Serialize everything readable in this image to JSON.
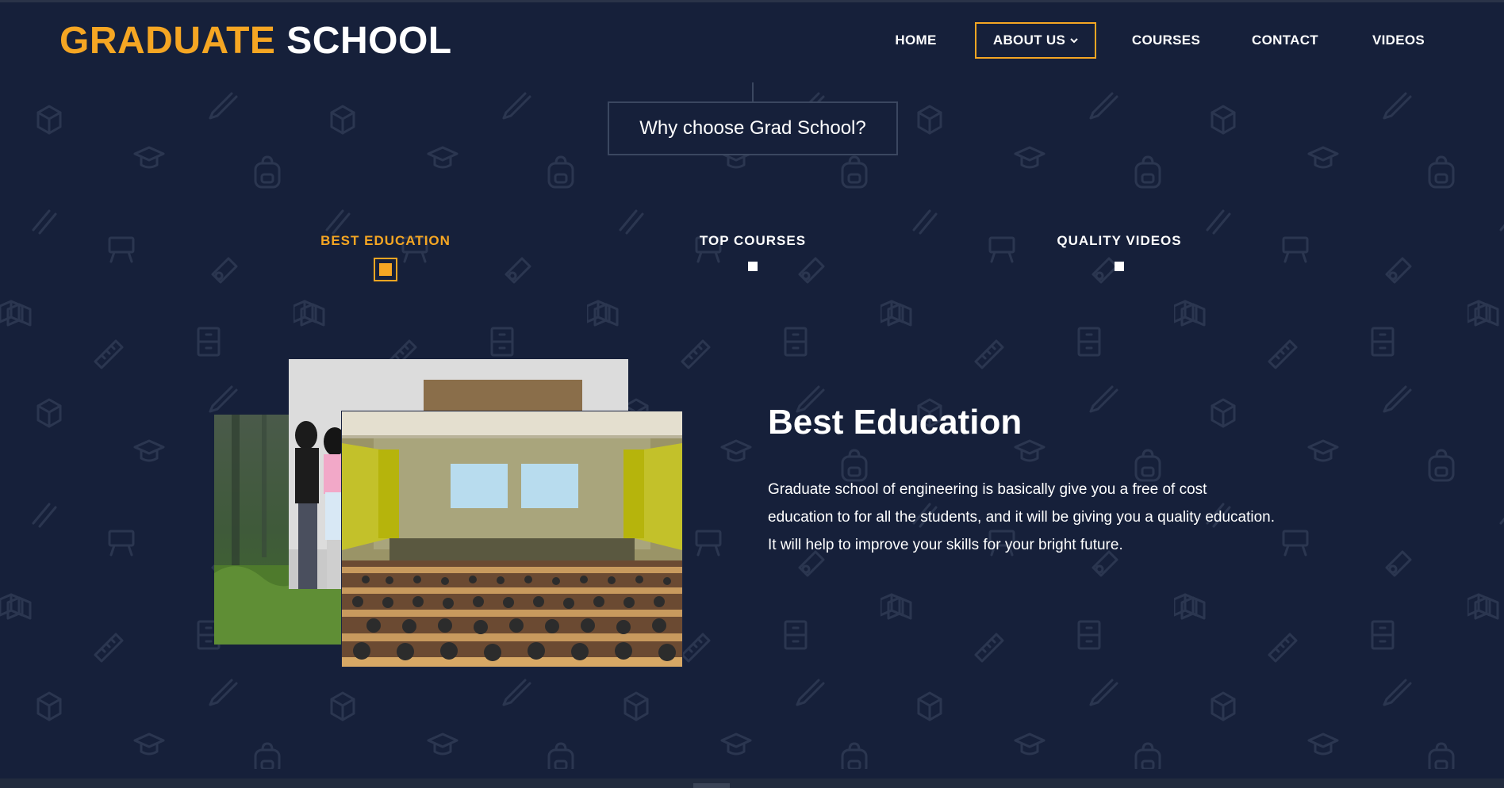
{
  "logo": {
    "accent": "GRADUATE",
    "main": "SCHOOL"
  },
  "nav": {
    "items": [
      {
        "label": "HOME"
      },
      {
        "label": "ABOUT US"
      },
      {
        "label": "COURSES"
      },
      {
        "label": "CONTACT"
      },
      {
        "label": "VIDEOS"
      }
    ],
    "active_item": "ABOUT US",
    "dropdown_icon": "chevron-down-icon"
  },
  "section": {
    "title": "Why choose Grad School?"
  },
  "tabs": [
    {
      "label": "BEST EDUCATION"
    },
    {
      "label": "TOP COURSES"
    },
    {
      "label": "QUALITY VIDEOS"
    }
  ],
  "active_tab": "BEST EDUCATION",
  "content": {
    "heading": "Best Education",
    "body": "Graduate school of engineering is basically give you a free of cost education to for all the students, and it will be giving you a quality education. It will help to improve your skills for your bright future."
  },
  "colors": {
    "background": "#16203a",
    "accent": "#f5a623",
    "text": "#ffffff",
    "pattern_icons": "#2b3650"
  },
  "background_icons": [
    "pencil-icon",
    "cube-icon",
    "graduation-cap-icon",
    "backpack-icon",
    "easel-icon",
    "diploma-icon",
    "book-icon",
    "cabinet-icon",
    "ruler-icon"
  ]
}
